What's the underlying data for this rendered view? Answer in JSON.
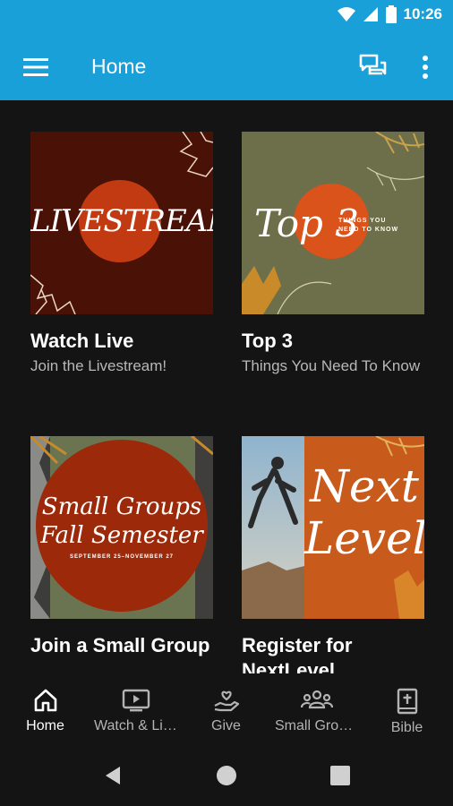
{
  "status": {
    "time": "10:26"
  },
  "app_bar": {
    "title": "Home"
  },
  "cards": [
    {
      "title": "Watch Live",
      "subtitle": "Join the Livestream!",
      "art_text": "LIVESTREAM"
    },
    {
      "title": "Top 3",
      "subtitle": "Things You Need To Know",
      "art_text": "Top 3",
      "art_subtext_1": "THINGS YOU",
      "art_subtext_2": "NEED TO KNOW"
    },
    {
      "title": "Join a Small Group",
      "subtitle": "",
      "art_text_1": "Small Groups",
      "art_text_2": "Fall Semester",
      "art_date": "SEPTEMBER 25–NOVEMBER 27"
    },
    {
      "title": "Register for NextLevel",
      "subtitle": "",
      "art_text_1": "Next",
      "art_text_2": "Level"
    }
  ],
  "nav": [
    {
      "label": "Home",
      "icon": "home-icon",
      "active": true
    },
    {
      "label": "Watch & Listen",
      "icon": "tv-play-icon",
      "active": false
    },
    {
      "label": "Give",
      "icon": "give-hand-heart-icon",
      "active": false
    },
    {
      "label": "Small Groups",
      "icon": "groups-icon",
      "active": false
    },
    {
      "label": "Bible",
      "icon": "bible-icon",
      "active": false
    }
  ],
  "colors": {
    "app_bar": "#1aa0d8",
    "background": "#141414",
    "accent_orange": "#d9531a"
  }
}
